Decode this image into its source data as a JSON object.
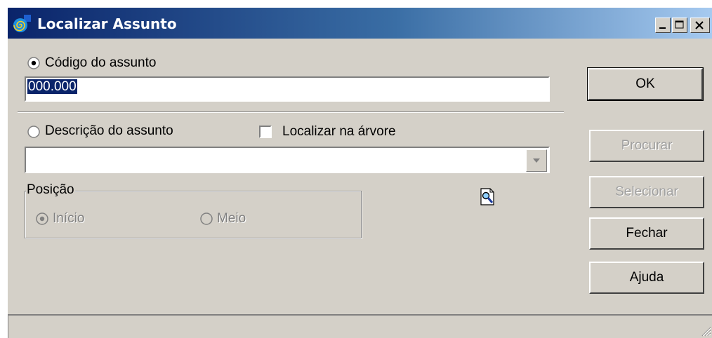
{
  "window": {
    "title": "Localizar Assunto",
    "icon": "spiral-app-icon",
    "controls": [
      "minimize-icon",
      "maximize-icon",
      "close-icon"
    ]
  },
  "code_section": {
    "radio_label": "Código do assunto",
    "radio_checked": true,
    "input_value": "000.000"
  },
  "description_section": {
    "radio_label": "Descrição do assunto",
    "radio_checked": false,
    "checkbox_label": "Localizar na árvore",
    "checkbox_checked": false,
    "combo_value": ""
  },
  "position_group": {
    "label": "Posição",
    "options": [
      {
        "label": "Início",
        "checked": true
      },
      {
        "label": "Meio",
        "checked": false
      }
    ]
  },
  "buttons": {
    "ok": "OK",
    "search": "Procurar",
    "select": "Selecionar",
    "close": "Fechar",
    "help": "Ajuda"
  },
  "icons": {
    "find": "magnifier-document-icon"
  },
  "colors": {
    "titlebar_start": "#0a246a",
    "titlebar_end": "#a6caf0",
    "face": "#d4d0c8",
    "selection": "#0a246a"
  }
}
